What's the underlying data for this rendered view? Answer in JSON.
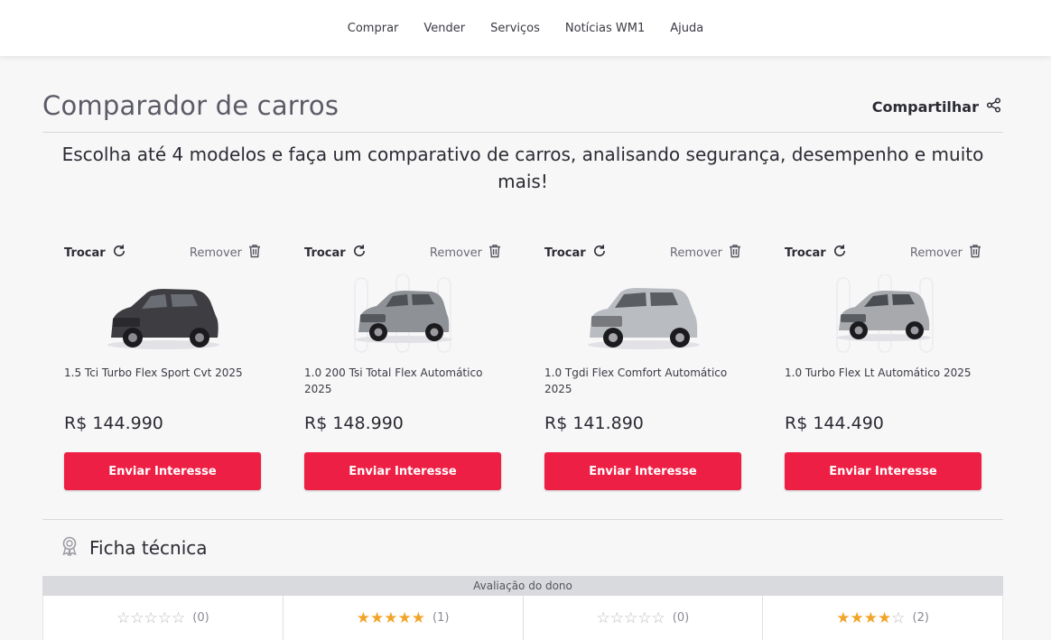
{
  "nav": {
    "items": [
      {
        "label": "Comprar"
      },
      {
        "label": "Vender"
      },
      {
        "label": "Serviços"
      },
      {
        "label": "Notícias WM1"
      },
      {
        "label": "Ajuda"
      }
    ]
  },
  "header": {
    "title": "Comparador de carros",
    "share_label": "Compartilhar",
    "share_icon": "share-icon"
  },
  "intro": {
    "text": "Escolha até 4 modelos e faça um comparativo de carros, analisando segurança, desempenho e muito mais!"
  },
  "cards": [
    {
      "swap_label": "Trocar",
      "remove_label": "Remover",
      "model": "1.5 Tci Turbo Flex Sport Cvt 2025",
      "price": "R$ 144.990",
      "cta": "Enviar Interesse",
      "car_color": "#3d3d42"
    },
    {
      "swap_label": "Trocar",
      "remove_label": "Remover",
      "model": "1.0 200 Tsi Total Flex Automático 2025",
      "price": "R$ 148.990",
      "cta": "Enviar Interesse",
      "car_color": "#8e9296"
    },
    {
      "swap_label": "Trocar",
      "remove_label": "Remover",
      "model": "1.0 Tgdi Flex Comfort Automático 2025",
      "price": "R$ 141.890",
      "cta": "Enviar Interesse",
      "car_color": "#b9bcc0"
    },
    {
      "swap_label": "Trocar",
      "remove_label": "Remover",
      "model": "1.0 Turbo Flex Lt Automático 2025",
      "price": "R$ 144.490",
      "cta": "Enviar Interesse",
      "car_color": "#a7a9ad"
    }
  ],
  "spec": {
    "title": "Ficha técnica",
    "icon": "award-icon"
  },
  "owner_rating": {
    "label": "Avaliação do dono",
    "ratings": [
      {
        "stars": 0,
        "count": "(0)"
      },
      {
        "stars": 5,
        "count": "(1)"
      },
      {
        "stars": 0,
        "count": "(0)"
      },
      {
        "stars": 4,
        "count": "(2)"
      }
    ]
  },
  "colors": {
    "accent": "#ee1f45",
    "star": "#f0a52a"
  }
}
